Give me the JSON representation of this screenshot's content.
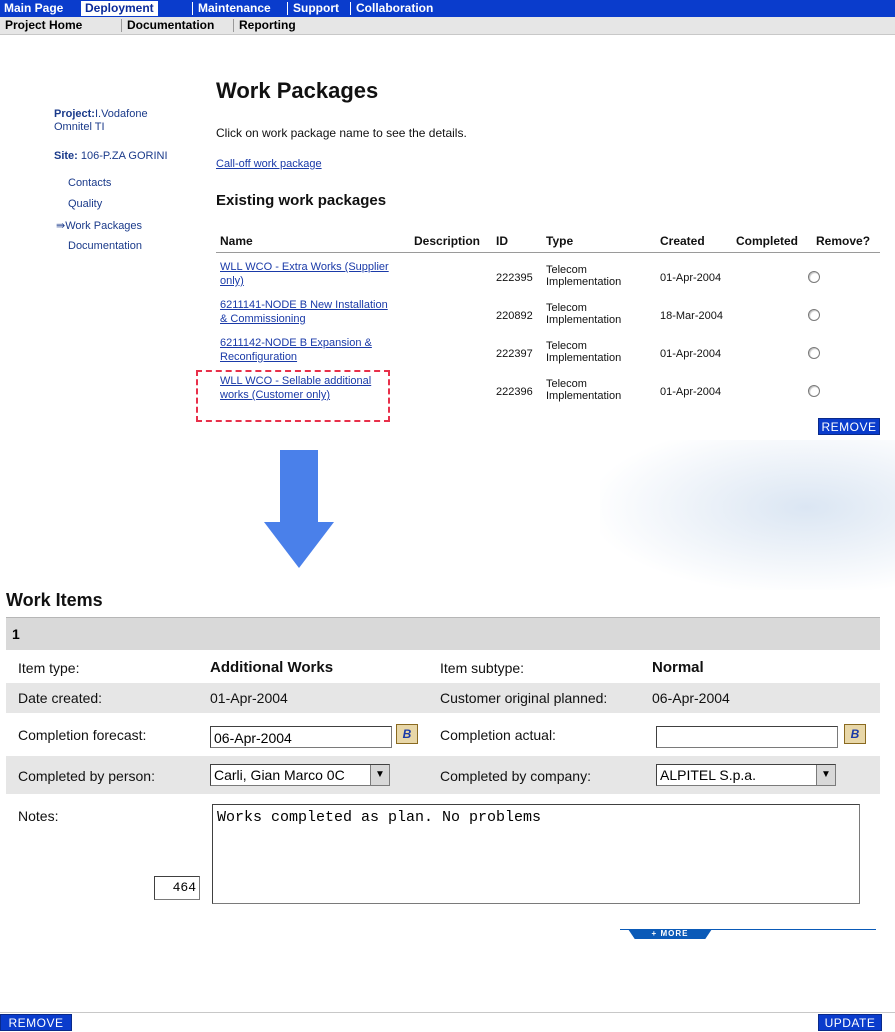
{
  "nav": {
    "main_page": "Main Page",
    "deployment": "Deployment",
    "maintenance": "Maintenance",
    "support": "Support",
    "collaboration": "Collaboration"
  },
  "subnav": {
    "project_home": "Project Home",
    "documentation": "Documentation",
    "reporting": "Reporting"
  },
  "sidebar": {
    "project_label": "Project:",
    "project_name_1": "I.Vodafone",
    "project_name_2": "Omnitel TI",
    "site_label": "Site:",
    "site_name": "106-P.ZA GORINI",
    "links": [
      "Contacts",
      "Quality",
      "Work Packages",
      "Documentation"
    ],
    "active_marker": "⇛"
  },
  "work_packages": {
    "title": "Work Packages",
    "hint": "Click on work package name to see the details.",
    "calloff_link": "Call-off work package",
    "existing_title": "Existing work packages",
    "columns": [
      "Name",
      "Description",
      "ID",
      "Type",
      "Created",
      "Completed",
      "Remove?"
    ],
    "rows": [
      {
        "name": "WLL WCO - Extra Works (Supplier only)",
        "id": "222395",
        "type_1": "Telecom",
        "type_2": "Implementation",
        "created": "01-Apr-2004"
      },
      {
        "name": "6211141-NODE B New Installation & Commissioning",
        "id": "220892",
        "type_1": "Telecom",
        "type_2": "Implementation",
        "created": "18-Mar-2004"
      },
      {
        "name": "6211142-NODE B Expansion & Reconfiguration",
        "id": "222397",
        "type_1": "Telecom",
        "type_2": "Implementation",
        "created": "01-Apr-2004"
      },
      {
        "name": "WLL WCO - Sellable additional works (Customer only)",
        "id": "222396",
        "type_1": "Telecom",
        "type_2": "Implementation",
        "created": "01-Apr-2004"
      }
    ],
    "remove_button": "REMOVE"
  },
  "work_items": {
    "title": "Work Items",
    "item_number": "1",
    "item_type_label": "Item type:",
    "item_type_value": "Additional Works",
    "item_subtype_label": "Item subtype:",
    "item_subtype_value": "Normal",
    "date_created_label": "Date created:",
    "date_created_value": "01-Apr-2004",
    "customer_planned_label": "Customer original planned:",
    "customer_planned_value": "06-Apr-2004",
    "completion_forecast_label": "Completion forecast:",
    "completion_forecast_value": "06-Apr-2004",
    "completion_actual_label": "Completion actual:",
    "completion_actual_value": "",
    "completed_by_person_label": "Completed by person:",
    "completed_by_person_value": "Carli, Gian Marco 0C",
    "completed_by_company_label": "Completed by company:",
    "completed_by_company_value": "ALPITEL S.p.a.",
    "notes_label": "Notes:",
    "notes_value": "Works completed as plan. No problems",
    "char_counter": "464",
    "more_label": "+ MORE",
    "calendar_glyph": "B"
  },
  "footer": {
    "remove_button": "REMOVE",
    "update_button": "UPDATE"
  },
  "colors": {
    "nav_blue": "#0a3ccc",
    "link_blue": "#1a3aa8",
    "arrow_blue": "#4a80ea",
    "highlight_red": "#e8304a"
  }
}
